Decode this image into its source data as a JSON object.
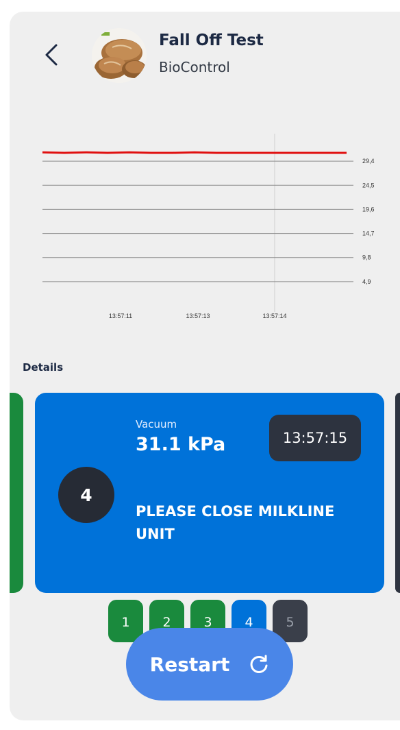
{
  "header": {
    "title": "Fall Off Test",
    "subtitle": "BioControl"
  },
  "details_label": "Details",
  "card": {
    "vacuum_label": "Vacuum",
    "vacuum_value": "31.1 kPa",
    "time": "13:57:15",
    "step_number": "4",
    "instruction": "PLEASE CLOSE MILKLINE UNIT"
  },
  "steps": [
    {
      "label": "1",
      "color": "#1a8a3d"
    },
    {
      "label": "2",
      "color": "#1a8a3d"
    },
    {
      "label": "3",
      "color": "#1a8a3d"
    },
    {
      "label": "4",
      "color": "#0072d9"
    },
    {
      "label": "5",
      "color": "#3a3f4a"
    }
  ],
  "restart_label": "Restart",
  "colors": {
    "line": "#e01010",
    "grid": "#8a8a8a",
    "accent": "#0072d9",
    "done": "#1a8a3d"
  },
  "chart_data": {
    "type": "line",
    "y_ticks": [
      "29,4",
      "24,5",
      "19,6",
      "14,7",
      "9,8",
      "4,9"
    ],
    "x_ticks": [
      "13:57:11",
      "13:57:13",
      "13:57:14"
    ],
    "ylim": [
      0,
      34.3
    ],
    "series": [
      {
        "values": [
          31.2,
          31.1,
          31.2,
          31.1,
          31.2,
          31.1,
          31.1,
          31.2,
          31.1,
          31.1,
          31.1,
          31.1,
          31.1,
          31.1,
          31.1
        ]
      }
    ]
  }
}
